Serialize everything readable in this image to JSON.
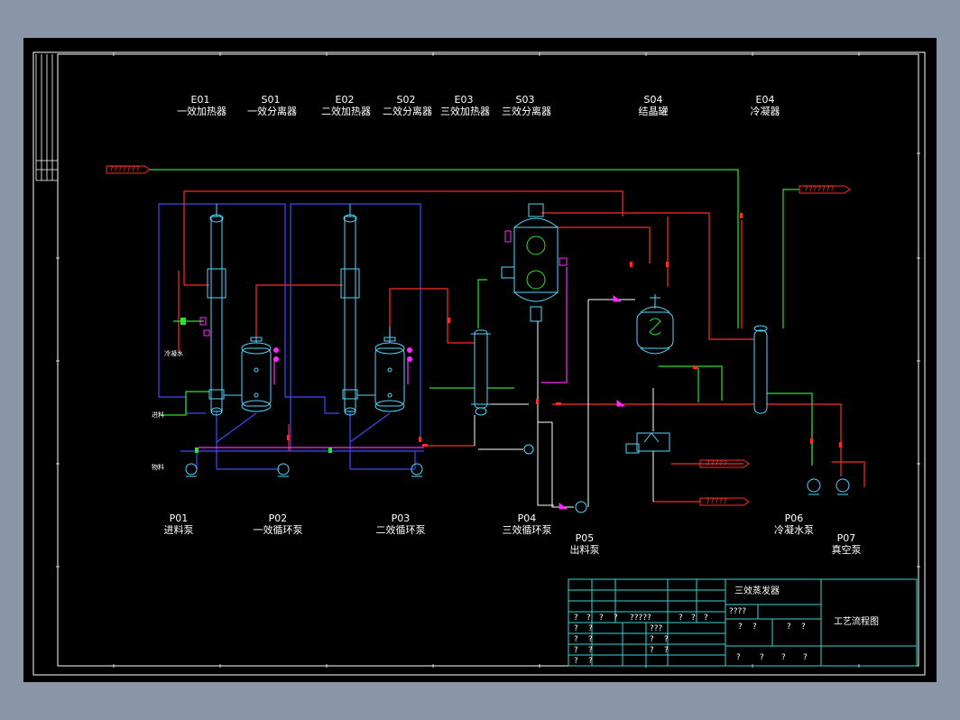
{
  "colors": {
    "background_outer": "#8a96a8",
    "drawing_bg": "#000000",
    "steam_line": "#ff2a2a",
    "material_line": "#3a4cff",
    "water_line": "#2fe02f",
    "vapor_line": "#ffffff",
    "vessel": "#4fd7ff",
    "instrument": "#ff2aff",
    "frame": "#ffffff",
    "title_block": "#2fd7d7"
  },
  "equipment_top": [
    {
      "code": "E01",
      "name": "一效加热器"
    },
    {
      "code": "S01",
      "name": "一效分离器"
    },
    {
      "code": "E02",
      "name": "二效加热器"
    },
    {
      "code": "S02",
      "name": "二效分离器"
    },
    {
      "code": "E03",
      "name": "三效加热器"
    },
    {
      "code": "S03",
      "name": "三效分离器"
    },
    {
      "code": "S04",
      "name": "结晶罐"
    },
    {
      "code": "E04",
      "name": "冷凝器"
    }
  ],
  "pumps": [
    {
      "code": "P01",
      "name": "进料泵"
    },
    {
      "code": "P02",
      "name": "一效循环泵"
    },
    {
      "code": "P03",
      "name": "二效循环泵"
    },
    {
      "code": "P04",
      "name": "三效循环泵"
    },
    {
      "code": "P05",
      "name": "出料泵"
    },
    {
      "code": "P06",
      "name": "冷凝水泵"
    },
    {
      "code": "P07",
      "name": "真空泵"
    }
  ],
  "line_tags": {
    "steam_in": "???????",
    "vent_out": "???????",
    "outlet_1": "?????",
    "outlet_2": "?????"
  },
  "side_labels": {
    "condensate": "冷凝水",
    "feed": "进料",
    "material": "物料"
  },
  "title_block": {
    "project": "三效蒸发器",
    "drawing": "工艺流程图",
    "code": "????",
    "q": "?",
    "q3": "???",
    "q5": "?????"
  }
}
